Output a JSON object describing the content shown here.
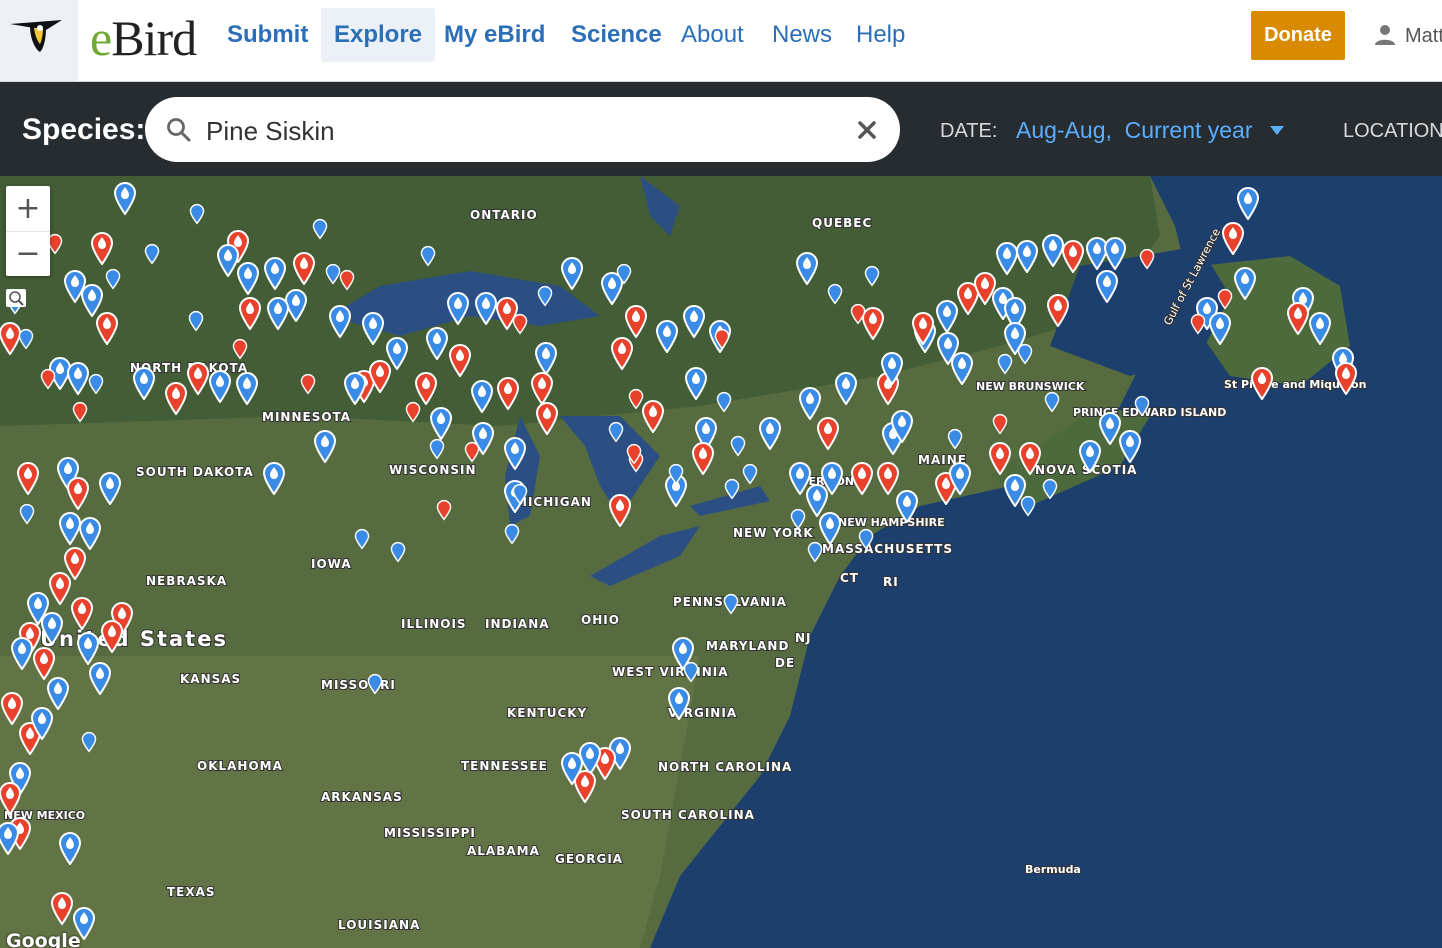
{
  "nav": {
    "logo_e": "e",
    "logo_rest": "Bird",
    "items": [
      {
        "label": "Submit",
        "bold": true
      },
      {
        "label": "Explore",
        "bold": true,
        "active": true
      },
      {
        "label": "My eBird",
        "bold": true
      },
      {
        "label": "Science",
        "bold": true
      },
      {
        "label": "About",
        "bold": false
      },
      {
        "label": "News",
        "bold": false
      },
      {
        "label": "Help",
        "bold": false
      }
    ],
    "donate_label": "Donate",
    "user_name": "Matt"
  },
  "search": {
    "species_label": "Species:",
    "species_value": "Pine Siskin",
    "date_label": "DATE:",
    "date_value": "Aug-Aug,  Current year",
    "location_label": "LOCATION:"
  },
  "map": {
    "google_label": "Google",
    "colors": {
      "recent_marker": "#e8412c",
      "older_marker": "#3a8be6",
      "land": "#556b3f",
      "water": "#1d3f6d"
    },
    "labels": [
      "ONTARIO",
      "QUEBEC",
      "NORTH DAKOTA",
      "MINNESOTA",
      "WISCONSIN",
      "MICHIGAN",
      "SOUTH DAKOTA",
      "NEBRASKA",
      "IOWA",
      "ILLINOIS",
      "INDIANA",
      "OHIO",
      "KANSAS",
      "MISSOURI",
      "KENTUCKY",
      "WEST VIRGINIA",
      "VIRGINIA",
      "PENNSYLVANIA",
      "NEW YORK",
      "MASSACHUSETTS",
      "NEW HAMPSHIRE",
      "VERMONT",
      "CT",
      "RI",
      "NJ",
      "MARYLAND",
      "DE",
      "OKLAHOMA",
      "TENNESSEE",
      "NORTH CAROLINA",
      "ARKANSAS",
      "SOUTH CAROLINA",
      "MISSISSIPPI",
      "ALABAMA",
      "GEORGIA",
      "TEXAS",
      "LOUISIANA",
      "NEW BRUNSWICK",
      "PRINCE EDWARD ISLAND",
      "NOVA SCOTIA",
      "MAINE",
      "St Pierre and Miquelon",
      "Gulf of St Lawrence",
      "Bermuda",
      "United States",
      "NEW MEXICO"
    ]
  }
}
